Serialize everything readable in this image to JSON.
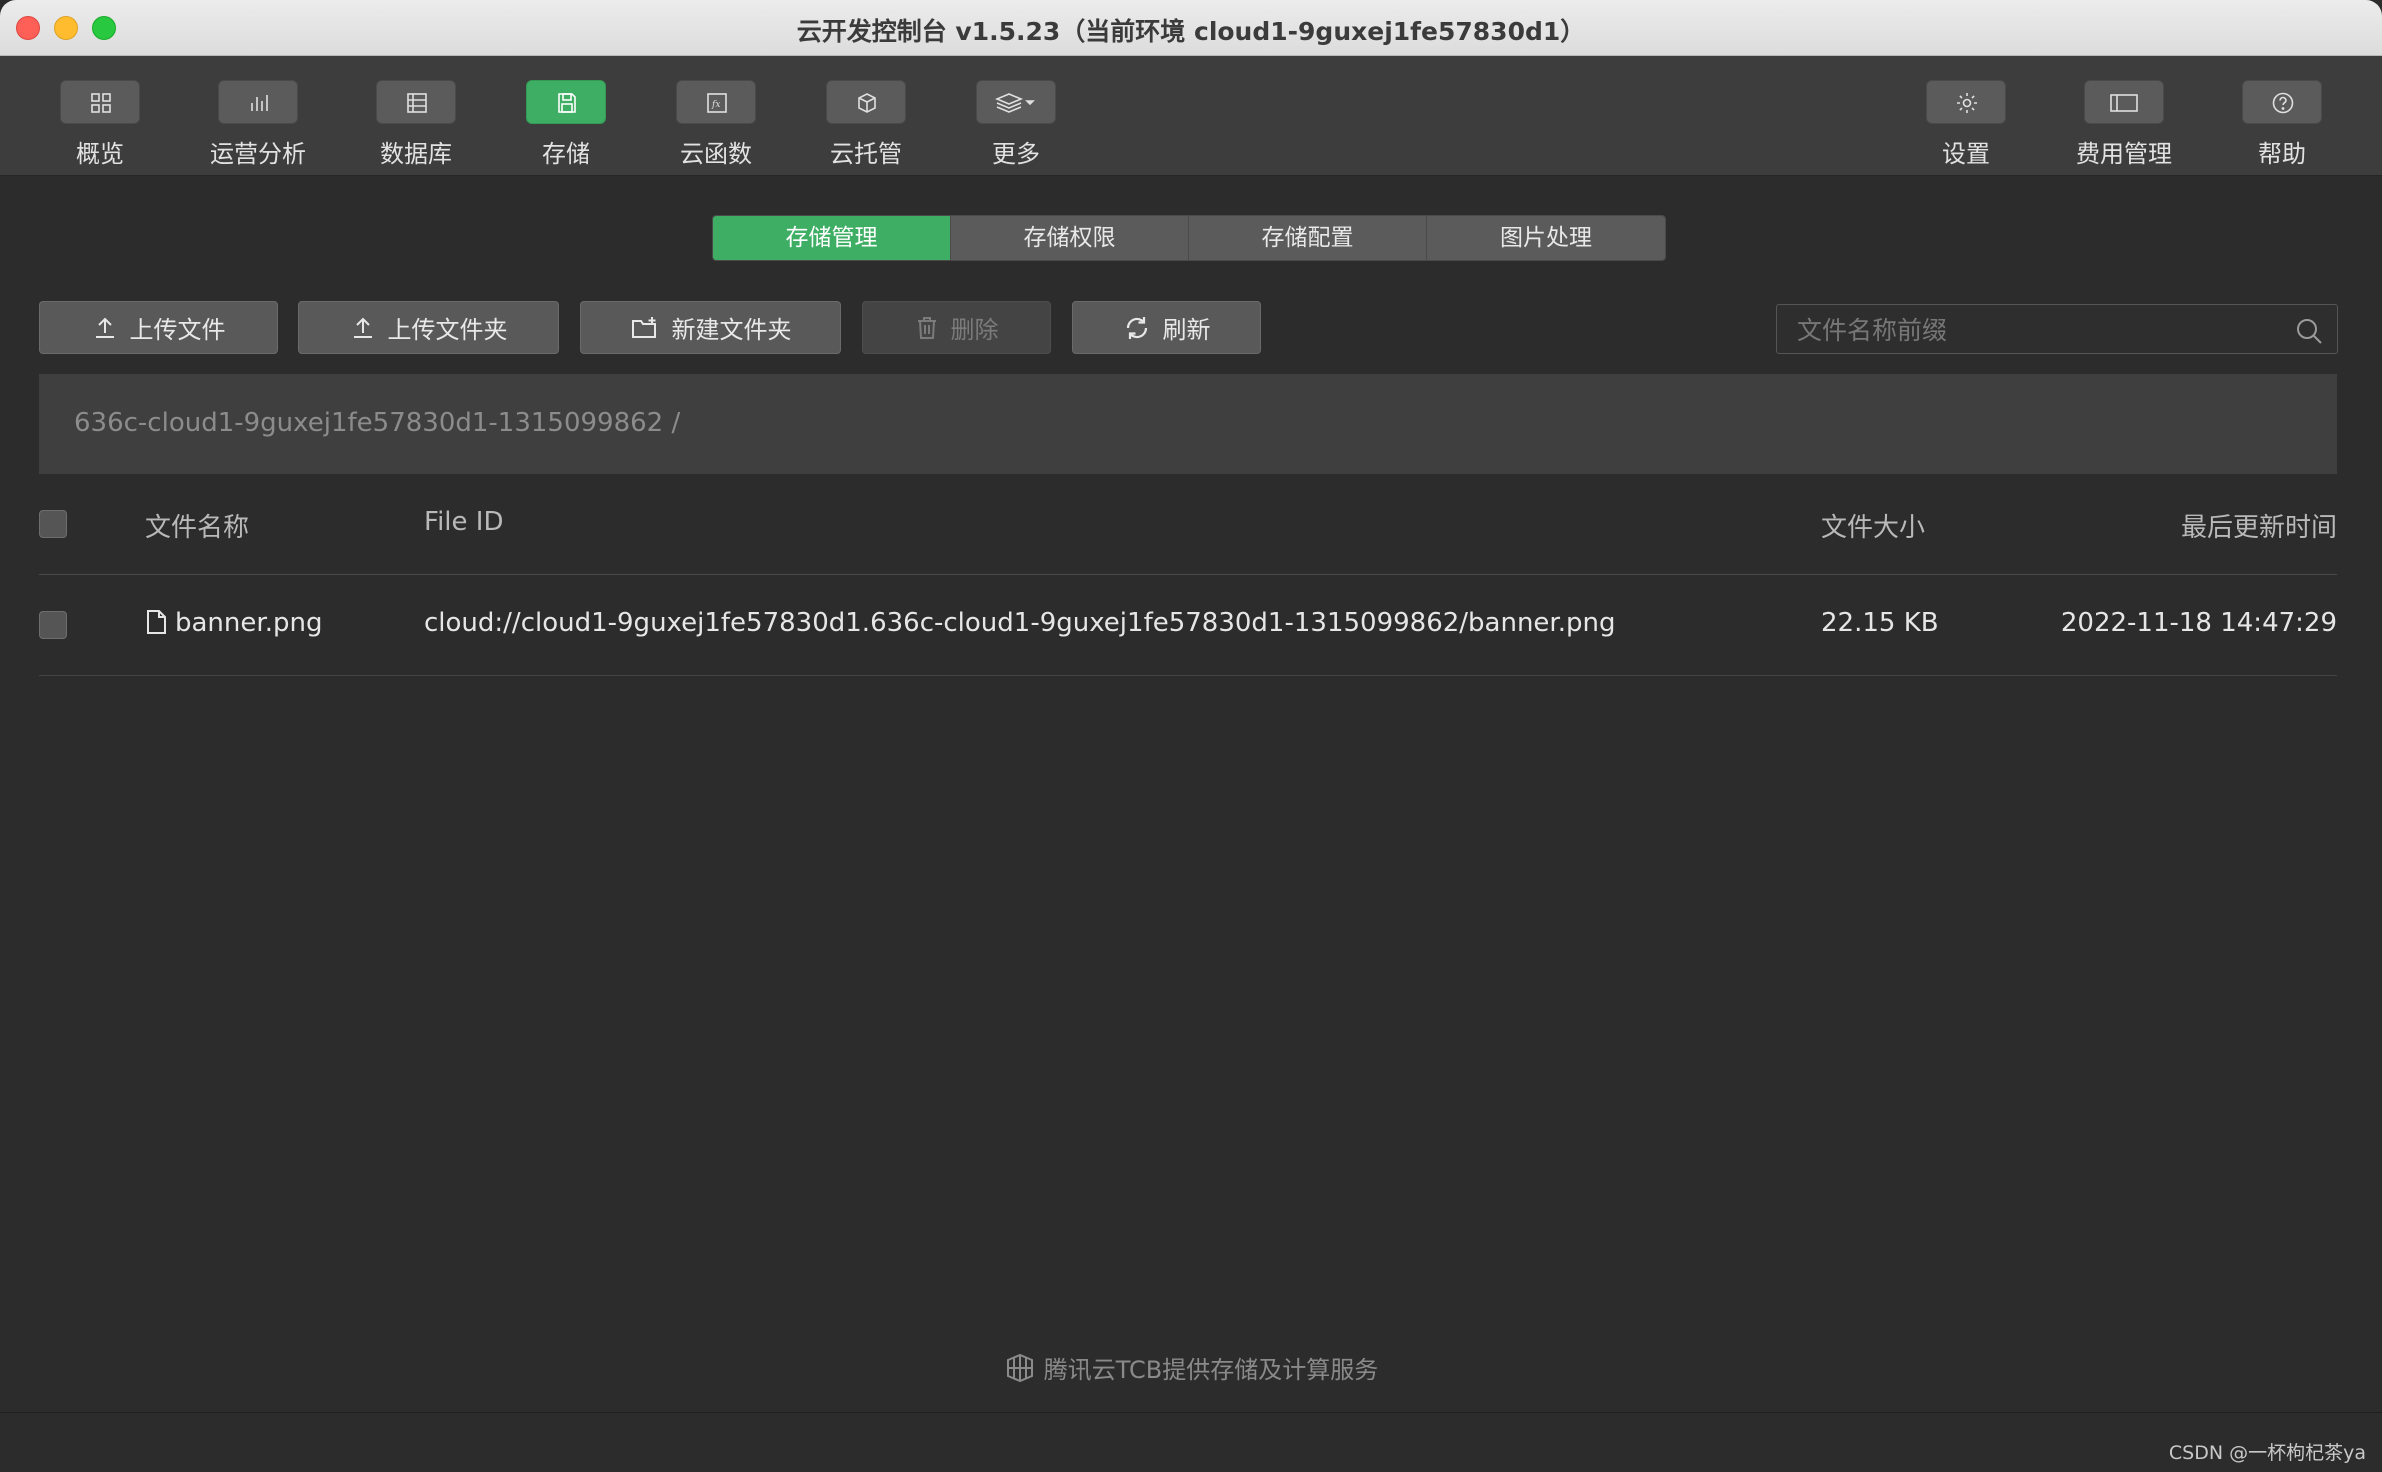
{
  "window": {
    "title": "云开发控制台 v1.5.23（当前环境 cloud1-9guxej1fe57830d1）"
  },
  "toolbar": {
    "left_items": [
      {
        "label": "概览",
        "icon": "overview-grid-icon"
      },
      {
        "label": "运营分析",
        "icon": "bar-chart-icon"
      },
      {
        "label": "数据库",
        "icon": "database-icon"
      },
      {
        "label": "存储",
        "icon": "storage-save-icon",
        "active": true
      },
      {
        "label": "云函数",
        "icon": "function-fx-icon"
      },
      {
        "label": "云托管",
        "icon": "cube-icon"
      },
      {
        "label": "更多",
        "icon": "layers-dropdown-icon"
      }
    ],
    "right_items": [
      {
        "label": "设置",
        "icon": "gear-icon"
      },
      {
        "label": "费用管理",
        "icon": "billing-icon"
      },
      {
        "label": "帮助",
        "icon": "help-icon"
      }
    ]
  },
  "tabs": [
    "存储管理",
    "存储权限",
    "存储配置",
    "图片处理"
  ],
  "active_tab": "存储管理",
  "actions": {
    "upload_file": "上传文件",
    "upload_folder": "上传文件夹",
    "new_folder": "新建文件夹",
    "delete": "删除",
    "refresh": "刷新"
  },
  "search": {
    "placeholder": "文件名称前缀",
    "value": ""
  },
  "breadcrumb": "636c-cloud1-9guxej1fe57830d1-1315099862 /",
  "table": {
    "columns": {
      "name": "文件名称",
      "file_id": "File ID",
      "size": "文件大小",
      "updated": "最后更新时间"
    },
    "rows": [
      {
        "name": "banner.png",
        "file_id": "cloud://cloud1-9guxej1fe57830d1.636c-cloud1-9guxej1fe57830d1-1315099862/banner.png",
        "size": "22.15 KB",
        "updated": "2022-11-18 14:47:29"
      }
    ]
  },
  "footer": "腾讯云TCB提供存储及计算服务",
  "watermark": "CSDN @一杯枸杞茶ya",
  "colors": {
    "accent": "#3dae63",
    "background": "#2c2c2c",
    "toolbar": "#3d3d3d"
  }
}
